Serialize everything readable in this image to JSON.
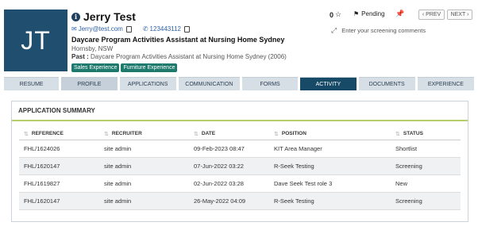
{
  "candidate": {
    "initials": "JT",
    "name": "Jerry Test",
    "email": "Jerry@test.com",
    "phone": "123443112",
    "job_title": "Daycare Program Activities Assistant at Nursing Home Sydney",
    "location": "Hornsby, NSW",
    "past_label": "Past :",
    "past_value": "Daycare Program Activities Assistant at Nursing Home Sydney (2006)",
    "tags": [
      "Sales Experience",
      "Furniture Experience"
    ]
  },
  "header": {
    "rating": "0",
    "status": "Pending",
    "prev_label": "‹ PREV",
    "next_label": "NEXT ›",
    "screening_placeholder": "Enter your screening comments"
  },
  "tabs": [
    {
      "label": "RESUME"
    },
    {
      "label": "PROFILE"
    },
    {
      "label": "APPLICATIONS"
    },
    {
      "label": "COMMUNICATION"
    },
    {
      "label": "FORMS"
    },
    {
      "label": "ACTIVITY"
    },
    {
      "label": "DOCUMENTS"
    },
    {
      "label": "EXPERIENCE"
    }
  ],
  "summary": {
    "title": "APPLICATION SUMMARY",
    "columns": [
      "REFERENCE",
      "RECRUITER",
      "DATE",
      "POSITION",
      "STATUS"
    ],
    "rows": [
      [
        "FHL/1624026",
        "site admin",
        "09-Feb-2023 08:47",
        "KIT Area Manager",
        "Shortlist"
      ],
      [
        "FHL/1620147",
        "site admin",
        "07-Jun-2022 03:22",
        "R-Seek Testing",
        "Screening"
      ],
      [
        "FHL/1619827",
        "site admin",
        "02-Jun-2022 03:28",
        "Dave Seek Test role 3",
        "New"
      ],
      [
        "FHL/1620147",
        "site admin",
        "26-May-2022 04:09",
        "R-Seek Testing",
        "Screening"
      ]
    ]
  },
  "colors": {
    "avatar_bg": "#1f4e6e",
    "tag_bg": "#1e7a6d",
    "active_tab": "#174a66",
    "accent_line": "#b6cf6a"
  }
}
